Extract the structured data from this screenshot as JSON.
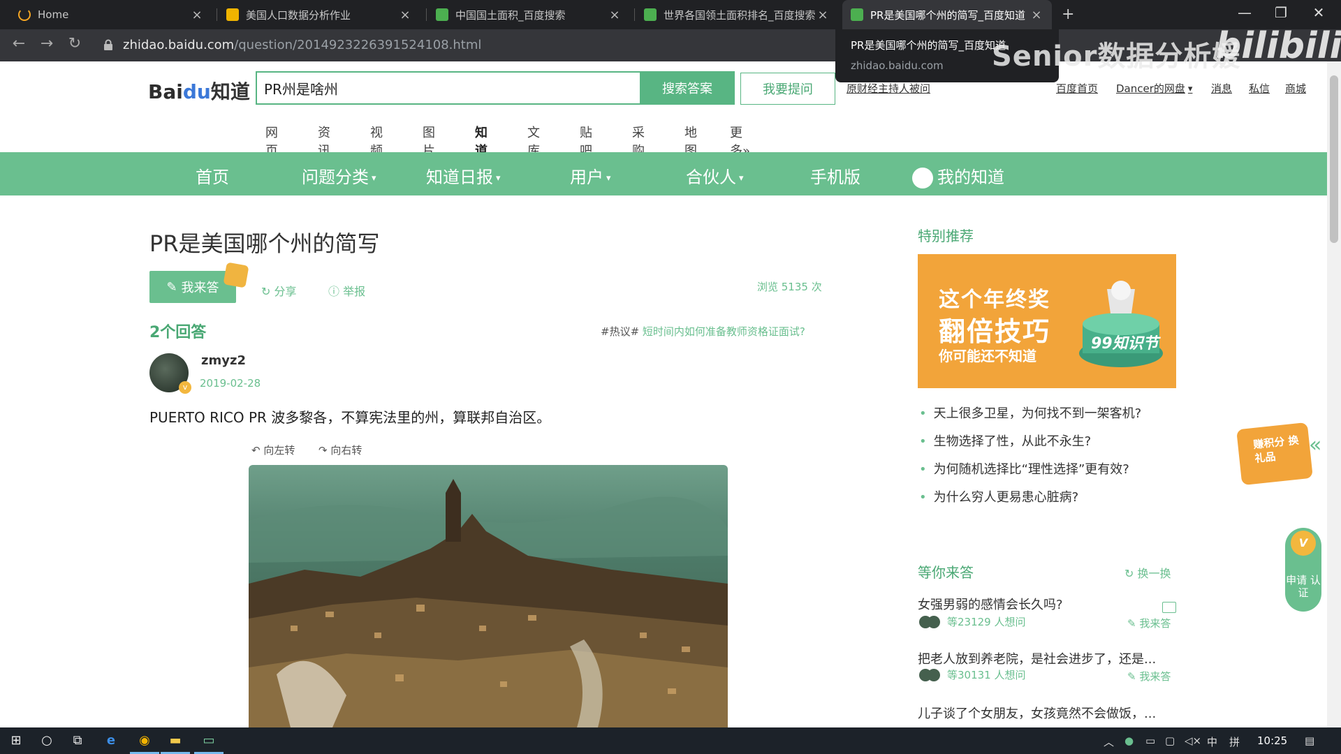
{
  "browser": {
    "tabs": [
      {
        "title": "Home",
        "favicon_color": "#f6a623"
      },
      {
        "title": "美国人口数据分析作业",
        "favicon_color": "#f0b400"
      },
      {
        "title": "中国国土面积_百度搜索",
        "favicon_color": "#4caf50"
      },
      {
        "title": "世界各国领土面积排名_百度搜索",
        "favicon_color": "#4caf50"
      },
      {
        "title": "PR是美国哪个州的简写_百度知道",
        "favicon_color": "#4caf50"
      }
    ],
    "new_tab": "+",
    "url_domain": "zhidao.baidu.com",
    "url_path": "/question/2014923226391524108.html",
    "tooltip": {
      "title": "PR是美国哪个州的简写_百度知道",
      "domain": "zhidao.baidu.com"
    },
    "watermark": "Senior数据分析媛",
    "bili_logo": "bilibili"
  },
  "header": {
    "logo": {
      "bai": "Bai",
      "paw": "du",
      "zhidao": "知道"
    },
    "search_value": "PR州是啥州",
    "search_button": "搜索答案",
    "ask_button": "我要提问",
    "host_link": "原财经主持人被问",
    "top_links": [
      "百度首页",
      "Dancer的网盘",
      "消息",
      "私信",
      "商城"
    ]
  },
  "nav_tabs": [
    "网页",
    "资讯",
    "视频",
    "图片",
    "知道",
    "文库",
    "贴吧",
    "采购",
    "地图",
    "更多»"
  ],
  "green_nav": [
    "首页",
    "问题分类",
    "知道日报",
    "用户",
    "合伙人",
    "手机版",
    "我的知道"
  ],
  "question": {
    "title": "PR是美国哪个州的简写",
    "answer_button": "我来答",
    "share": "分享",
    "report": "举报",
    "views": "浏览 5135 次",
    "answers_count": "2个回答",
    "hot_tag": "#热议#",
    "hot_link": "短时间内如何准备教师资格证面试?"
  },
  "answer": {
    "user": "zmyz2",
    "date": "2019-02-28",
    "text": "PUERTO RICO PR 波多黎各，不算宪法里的州，算联邦自治区。",
    "rotate_left": "向左转",
    "rotate_right": "向右转"
  },
  "sidebar": {
    "special_title": "特别推荐",
    "ad": {
      "line1": "这个年终奖",
      "line2": "翻倍技巧",
      "line3": "你可能还不知道",
      "badge": "99知识节"
    },
    "recommendations": [
      "天上很多卫星，为何找不到一架客机?",
      "生物选择了性，从此不永生?",
      "为何随机选择比“理性选择”更有效?",
      "为什么穷人更易患心脏病?"
    ],
    "waiting_title": "等你来答",
    "refresh": "换一换",
    "waiting": [
      {
        "q": "女强男弱的感情会长久吗?",
        "meta": "等23129 人想问",
        "answer": "我来答"
      },
      {
        "q": "把老人放到养老院，是社会进步了，还是...",
        "meta": "等30131 人想问",
        "answer": "我来答"
      },
      {
        "q": "儿子谈了个女朋友，女孩竟然不会做饭，...",
        "meta": "",
        "answer": ""
      }
    ]
  },
  "floating": {
    "gift": "赚积分 换礼品",
    "cert": "申请 认证"
  },
  "taskbar": {
    "clock": "10:25",
    "ime": "中",
    "layout": "拼"
  }
}
